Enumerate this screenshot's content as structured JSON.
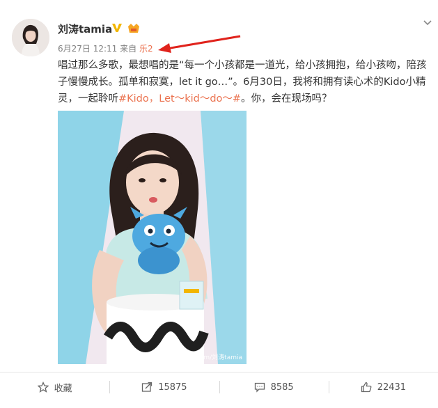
{
  "post": {
    "username": "刘涛tamia",
    "timestamp": "6月27日 12:11",
    "source_prefix": "来自",
    "source_name": "乐2",
    "text_part1": "唱过那么多歌，最想唱的是“每一个小孩都是一道光，给小孩拥抱，给小孩吻，陪孩子慢慢成长。孤单和寂寞，let it go…”。6月30日，我将和拥有读心术的Kido小精灵，一起聆听",
    "hashtag": "#Kido，Let～kid～do～#",
    "text_part2": "。你，会在现场吗？",
    "image_watermark": "weibo.com/刘涛tamia"
  },
  "actions": {
    "favorite_label": "收藏",
    "repost_count": "15875",
    "comment_count": "8585",
    "like_count": "22431"
  },
  "icons": {
    "verified": "verified-v-icon",
    "member": "vip-member-icon",
    "more": "chevron-down-icon",
    "favorite": "star-icon",
    "repost": "repost-icon",
    "comment": "comment-icon",
    "like": "thumbs-up-icon"
  },
  "colors": {
    "accent": "#eb7350",
    "verified": "#f2b600",
    "annotation_arrow": "#e0231c"
  }
}
